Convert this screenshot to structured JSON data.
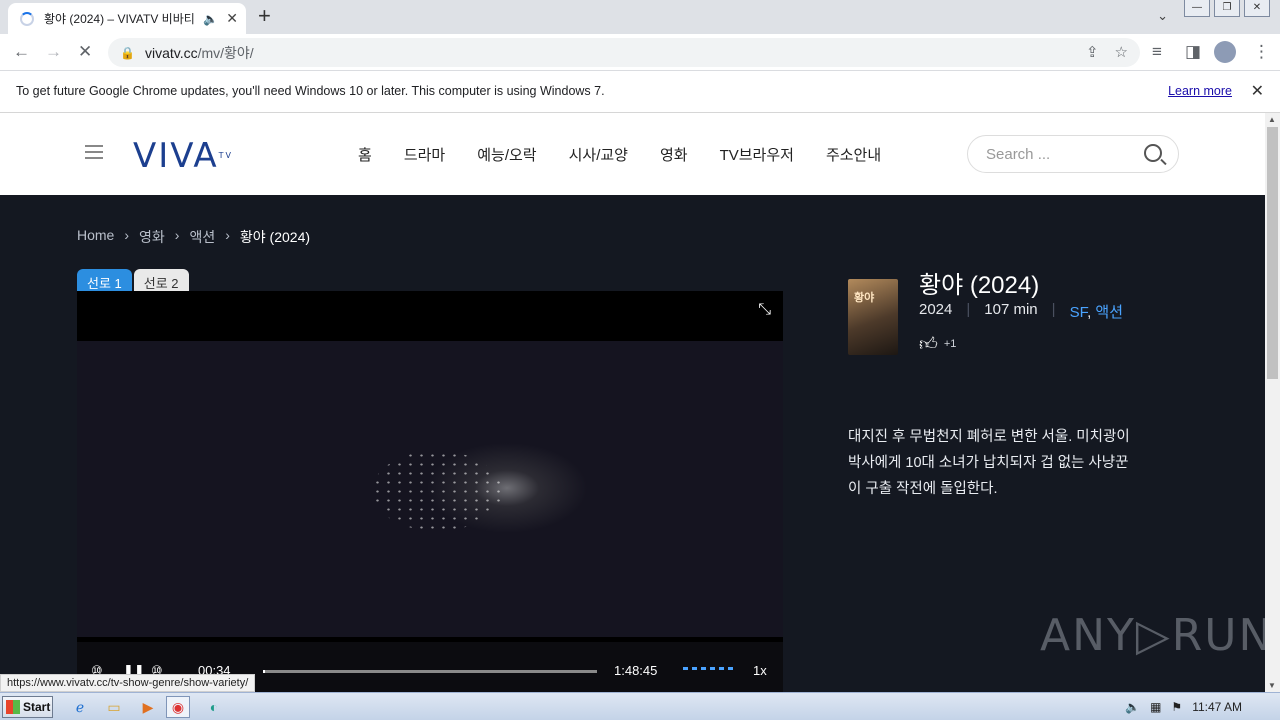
{
  "browser": {
    "tab_title": "황야 (2024) – VIVATV 비바티비",
    "audio_icon": "speaker-icon",
    "url_host": "vivatv.cc",
    "url_path": "/mv/황야/",
    "infobar_message": "To get future Google Chrome updates, you'll need Windows 10 or later. This computer is using Windows 7.",
    "infobar_link": "Learn more"
  },
  "site": {
    "logo": "VIVA",
    "logo_sup": "TV",
    "nav": [
      "홈",
      "드라마",
      "예능/오락",
      "시사/교양",
      "영화",
      "TV브라우저",
      "주소안내"
    ],
    "search_placeholder": "Search ..."
  },
  "breadcrumb": [
    "Home",
    "영화",
    "액션",
    "황야 (2024)"
  ],
  "server_tabs": [
    "선로 1",
    "선로 2"
  ],
  "player": {
    "current_time": "00:34",
    "duration": "1:48:45",
    "speed": "1x",
    "progress": 0.005
  },
  "movie": {
    "title": "황야 (2024)",
    "year": "2024",
    "runtime": "107 min",
    "genre_1": "SF",
    "genre_sep": ",",
    "genre_2": "액션",
    "likes": "+1",
    "poster_text": "황야",
    "description": "대지진 후 무법천지 폐허로 변한 서울. 미치광이 박사에게 10대 소녀가 납치되자 겁 없는 사냥꾼이 구출 작전에 돌입한다."
  },
  "watermark": "ANY▷RUN",
  "status_url": "https://www.vivatv.cc/tv-show-genre/show-variety/",
  "taskbar": {
    "start_label": "Start",
    "clock": "11:47 AM"
  }
}
